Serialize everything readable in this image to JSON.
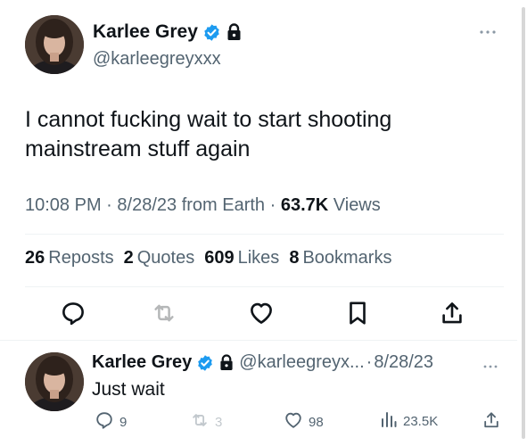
{
  "tweet": {
    "author": {
      "display_name": "Karlee Grey",
      "handle": "@karleegreyxxx",
      "verified": true,
      "protected": true
    },
    "more_icon": "more-horizontal-icon",
    "text": "I cannot fucking wait to start shooting mainstream stuff again",
    "meta": {
      "time": "10:08 PM",
      "date": "8/28/23",
      "source": "from Earth",
      "views_count": "63.7K",
      "views_label": "Views"
    },
    "stats": [
      {
        "count": "26",
        "label": "Reposts"
      },
      {
        "count": "2",
        "label": "Quotes"
      },
      {
        "count": "609",
        "label": "Likes"
      },
      {
        "count": "8",
        "label": "Bookmarks"
      }
    ],
    "actions": [
      "reply-icon",
      "repost-icon",
      "like-icon",
      "bookmark-icon",
      "share-icon"
    ]
  },
  "reply": {
    "author": {
      "display_name": "Karlee Grey",
      "handle": "@karleegreyx...",
      "date": "8/28/23",
      "verified": true,
      "protected": true
    },
    "text": "Just wait",
    "actions": {
      "reply_count": "9",
      "repost_count": "3",
      "like_count": "98",
      "views_count": "23.5K"
    }
  },
  "colors": {
    "text": "#0f1419",
    "secondary": "#536471",
    "verified": "#1d9bf0",
    "divider": "#eff3f4"
  }
}
